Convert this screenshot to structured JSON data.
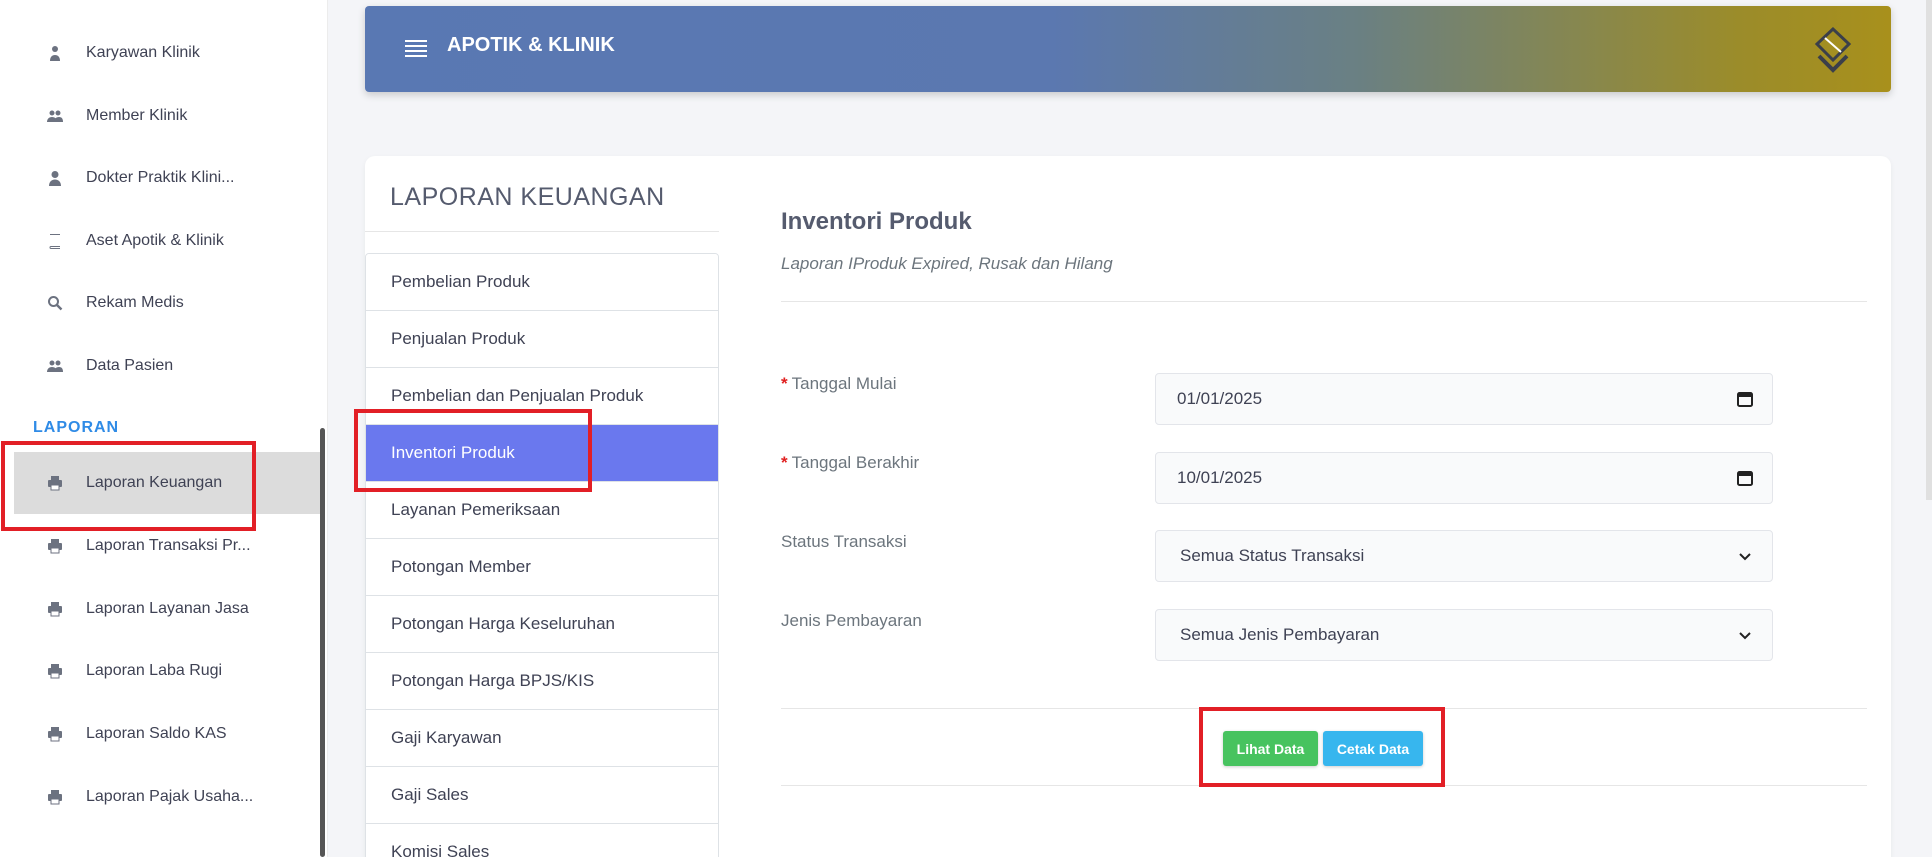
{
  "sidebar": {
    "items": [
      {
        "label": "Karyawan Klinik",
        "icon": "user-tie-icon"
      },
      {
        "label": "Member Klinik",
        "icon": "users-icon"
      },
      {
        "label": "Dokter Praktik Klini...",
        "icon": "user-icon"
      },
      {
        "label": "Aset Apotik & Klinik",
        "icon": "book-icon"
      },
      {
        "label": "Rekam Medis",
        "icon": "search-icon"
      },
      {
        "label": "Data Pasien",
        "icon": "users-icon"
      }
    ],
    "section_header": "LAPORAN",
    "report_items": [
      {
        "label": "Laporan Keuangan",
        "icon": "print-icon",
        "active": true
      },
      {
        "label": "Laporan Transaksi Pr...",
        "icon": "print-icon"
      },
      {
        "label": "Laporan Layanan Jasa",
        "icon": "print-icon"
      },
      {
        "label": "Laporan Laba Rugi",
        "icon": "print-icon"
      },
      {
        "label": "Laporan Saldo KAS",
        "icon": "print-icon"
      },
      {
        "label": "Laporan Pajak Usaha...",
        "icon": "print-icon"
      }
    ]
  },
  "header": {
    "title": "APOTIK & KLINIK"
  },
  "card": {
    "title": "LAPORAN KEUANGAN",
    "menu": [
      "Pembelian Produk",
      "Penjualan Produk",
      "Pembelian dan Penjualan Produk",
      "Inventori Produk",
      "Layanan Pemeriksaan",
      "Potongan Member",
      "Potongan Harga Keseluruhan",
      "Potongan Harga BPJS/KIS",
      "Gaji Karyawan",
      "Gaji Sales",
      "Komisi Sales"
    ],
    "active_menu": "Inventori Produk"
  },
  "content": {
    "title": "Inventori Produk",
    "subtitle": "Laporan IProduk Expired, Rusak dan Hilang",
    "fields": {
      "start_label": "Tanggal Mulai",
      "start_value": "01/01/2025",
      "end_label": "Tanggal Berakhir",
      "end_value": "10/01/2025",
      "status_label": "Status Transaksi",
      "status_value": "Semua Status Transaksi",
      "payment_label": "Jenis Pembayaran",
      "payment_value": "Semua Jenis Pembayaran",
      "required_mark": "*"
    },
    "buttons": {
      "view": "Lihat Data",
      "print": "Cetak Data"
    }
  },
  "colors": {
    "accent_active": "#6a78ee",
    "sidebar_header": "#2f8be6",
    "button_view": "#47c35f",
    "button_print": "#37b6ee",
    "highlight": "#e21f26"
  }
}
